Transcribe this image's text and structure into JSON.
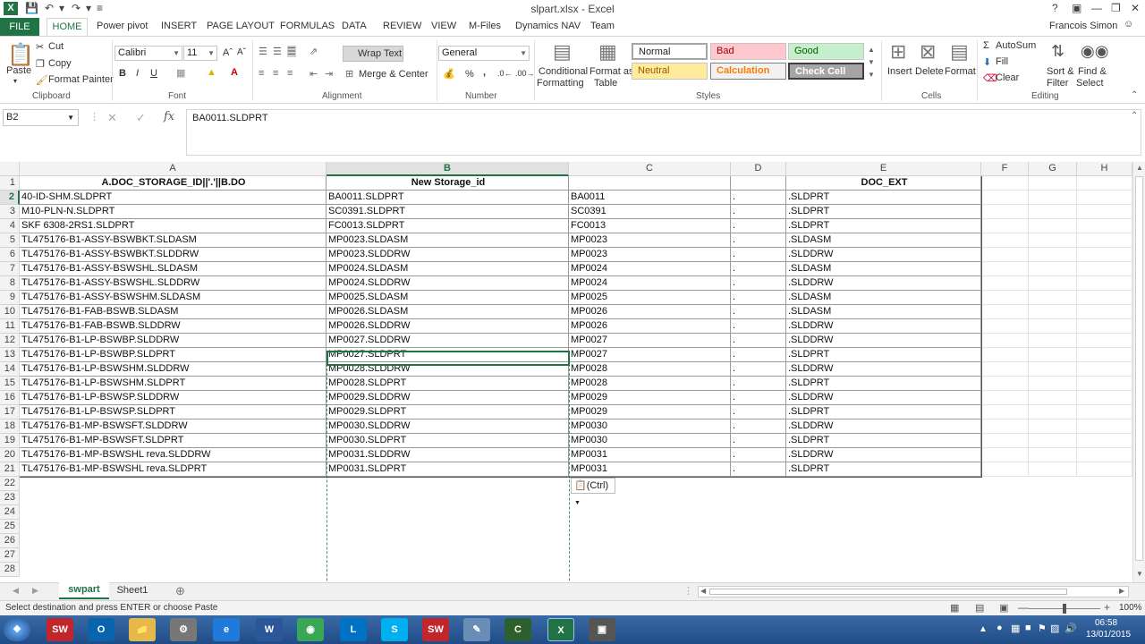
{
  "window": {
    "title": "slpart.xlsx - Excel",
    "user": "Francois Simon",
    "help": "?"
  },
  "tabs": [
    "FILE",
    "HOME",
    "Power pivot",
    "INSERT",
    "PAGE LAYOUT",
    "FORMULAS",
    "DATA",
    "REVIEW",
    "VIEW",
    "M-Files",
    "Dynamics NAV",
    "Team"
  ],
  "ribbon": {
    "clipboard": {
      "paste": "Paste",
      "cut": "Cut",
      "copy": "Copy",
      "format_painter": "Format Painter",
      "label": "Clipboard"
    },
    "font": {
      "name": "Calibri",
      "size": "11",
      "bold": "B",
      "italic": "I",
      "underline": "U",
      "label": "Font"
    },
    "alignment": {
      "wrap": "Wrap Text",
      "merge": "Merge & Center",
      "label": "Alignment"
    },
    "number": {
      "format": "General",
      "label": "Number",
      "percent": "%",
      "comma": ","
    },
    "styles": {
      "cond": "Conditional",
      "cond2": "Formatting",
      "fmt_table": "Format as",
      "fmt_table2": "Table",
      "normal": "Normal",
      "bad": "Bad",
      "good": "Good",
      "neutral": "Neutral",
      "calculation": "Calculation",
      "check": "Check Cell",
      "label": "Styles"
    },
    "cells": {
      "insert": "Insert",
      "delete": "Delete",
      "format": "Format",
      "label": "Cells"
    },
    "editing": {
      "autosum": "AutoSum",
      "fill": "Fill",
      "clear": "Clear",
      "sort": "Sort &",
      "sort2": "Filter",
      "find": "Find &",
      "find2": "Select",
      "label": "Editing"
    }
  },
  "formula_bar": {
    "name_box": "B2",
    "formula": "BA0011.SLDPRT",
    "fx": "fx"
  },
  "columns": [
    "A",
    "B",
    "C",
    "D",
    "E",
    "F",
    "G",
    "H"
  ],
  "header_row": [
    "A.DOC_STORAGE_ID||'.'||B.DO",
    "New Storage_id",
    "",
    "",
    "DOC_EXT"
  ],
  "rows": [
    [
      "40-ID-SHM.SLDPRT",
      "BA0011.SLDPRT",
      "BA0011",
      ".",
      ".SLDPRT"
    ],
    [
      "M10-PLN-N.SLDPRT",
      "SC0391.SLDPRT",
      "SC0391",
      ".",
      ".SLDPRT"
    ],
    [
      "SKF 6308-2RS1.SLDPRT",
      "FC0013.SLDPRT",
      "FC0013",
      ".",
      ".SLDPRT"
    ],
    [
      "TL475176-B1-ASSY-BSWBKT.SLDASM",
      "MP0023.SLDASM",
      "MP0023",
      ".",
      ".SLDASM"
    ],
    [
      "TL475176-B1-ASSY-BSWBKT.SLDDRW",
      "MP0023.SLDDRW",
      "MP0023",
      ".",
      ".SLDDRW"
    ],
    [
      "TL475176-B1-ASSY-BSWSHL.SLDASM",
      "MP0024.SLDASM",
      "MP0024",
      ".",
      ".SLDASM"
    ],
    [
      "TL475176-B1-ASSY-BSWSHL.SLDDRW",
      "MP0024.SLDDRW",
      "MP0024",
      ".",
      ".SLDDRW"
    ],
    [
      "TL475176-B1-ASSY-BSWSHM.SLDASM",
      "MP0025.SLDASM",
      "MP0025",
      ".",
      ".SLDASM"
    ],
    [
      "TL475176-B1-FAB-BSWB.SLDASM",
      "MP0026.SLDASM",
      "MP0026",
      ".",
      ".SLDASM"
    ],
    [
      "TL475176-B1-FAB-BSWB.SLDDRW",
      "MP0026.SLDDRW",
      "MP0026",
      ".",
      ".SLDDRW"
    ],
    [
      "TL475176-B1-LP-BSWBP.SLDDRW",
      "MP0027.SLDDRW",
      "MP0027",
      ".",
      ".SLDDRW"
    ],
    [
      "TL475176-B1-LP-BSWBP.SLDPRT",
      "MP0027.SLDPRT",
      "MP0027",
      ".",
      ".SLDPRT"
    ],
    [
      "TL475176-B1-LP-BSWSHM.SLDDRW",
      "MP0028.SLDDRW",
      "MP0028",
      ".",
      ".SLDDRW"
    ],
    [
      "TL475176-B1-LP-BSWSHM.SLDPRT",
      "MP0028.SLDPRT",
      "MP0028",
      ".",
      ".SLDPRT"
    ],
    [
      "TL475176-B1-LP-BSWSP.SLDDRW",
      "MP0029.SLDDRW",
      "MP0029",
      ".",
      ".SLDDRW"
    ],
    [
      "TL475176-B1-LP-BSWSP.SLDPRT",
      "MP0029.SLDPRT",
      "MP0029",
      ".",
      ".SLDPRT"
    ],
    [
      "TL475176-B1-MP-BSWSFT.SLDDRW",
      "MP0030.SLDDRW",
      "MP0030",
      ".",
      ".SLDDRW"
    ],
    [
      "TL475176-B1-MP-BSWSFT.SLDPRT",
      "MP0030.SLDPRT",
      "MP0030",
      ".",
      ".SLDPRT"
    ],
    [
      "TL475176-B1-MP-BSWSHL reva.SLDDRW",
      "MP0031.SLDDRW",
      "MP0031",
      ".",
      ".SLDDRW"
    ],
    [
      "TL475176-B1-MP-BSWSHL reva.SLDPRT",
      "MP0031.SLDPRT",
      "MP0031",
      ".",
      ".SLDPRT"
    ]
  ],
  "empty_rows": [
    "22",
    "23",
    "24",
    "25",
    "26",
    "27",
    "28"
  ],
  "paste_options": "(Ctrl)",
  "sheets": [
    "swpart",
    "Sheet1"
  ],
  "status": {
    "message": "Select destination and press ENTER or choose Paste",
    "zoom": "100%"
  },
  "clock": {
    "time": "06:58",
    "date": "13/01/2015"
  },
  "colors": {
    "excel_green": "#217346",
    "selection": "#217346"
  }
}
